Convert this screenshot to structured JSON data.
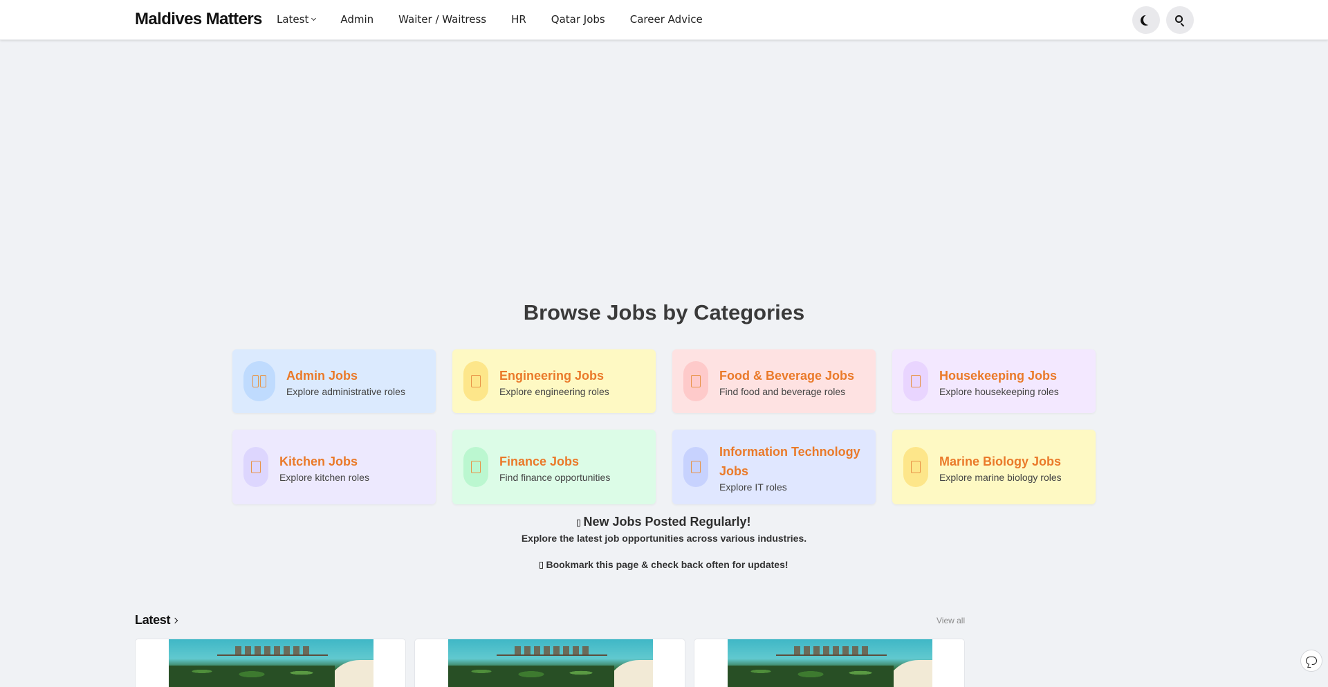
{
  "header": {
    "logo": "Maldives Matters",
    "nav": [
      {
        "label": "Latest",
        "has_dropdown": true
      },
      {
        "label": "Admin"
      },
      {
        "label": "Waiter / Waitress"
      },
      {
        "label": "HR"
      },
      {
        "label": "Qatar Jobs"
      },
      {
        "label": "Career Advice"
      }
    ],
    "icons": {
      "theme": "moon-icon",
      "search": "search-icon"
    }
  },
  "categories": {
    "title": "Browse Jobs by Categories",
    "items": [
      {
        "title": "Admin Jobs",
        "subtitle": "Explore administrative roles",
        "bg": "#dbeafe",
        "icon_bg": "#bfdbfe"
      },
      {
        "title": "Engineering Jobs",
        "subtitle": "Explore engineering roles",
        "bg": "#fef9c3",
        "icon_bg": "#fde68a"
      },
      {
        "title": "Food & Beverage Jobs",
        "subtitle": "Find food and beverage roles",
        "bg": "#fee2e2",
        "icon_bg": "#fecaca"
      },
      {
        "title": "Housekeeping Jobs",
        "subtitle": "Explore housekeeping roles",
        "bg": "#f3e8ff",
        "icon_bg": "#e9d5ff"
      },
      {
        "title": "Kitchen Jobs",
        "subtitle": "Explore kitchen roles",
        "bg": "#ede9fe",
        "icon_bg": "#ddd6fe"
      },
      {
        "title": "Finance Jobs",
        "subtitle": "Find finance opportunities",
        "bg": "#dcfce7",
        "icon_bg": "#bbf7d0"
      },
      {
        "title": "Information Technology Jobs",
        "subtitle": "Explore IT roles",
        "bg": "#e0e7ff",
        "icon_bg": "#c7d2fe"
      },
      {
        "title": "Marine Biology Jobs",
        "subtitle": "Explore marine biology roles",
        "bg": "#fef9c3",
        "icon_bg": "#fde68a"
      }
    ],
    "accent_color": "#ea7a2a"
  },
  "notice": {
    "headline": "New Jobs Posted Regularly!",
    "subline": "Explore the latest job opportunities across various industries.",
    "bookmark": "Bookmark this page & check back often for updates!"
  },
  "latest": {
    "heading": "Latest",
    "view_all": "View all"
  }
}
